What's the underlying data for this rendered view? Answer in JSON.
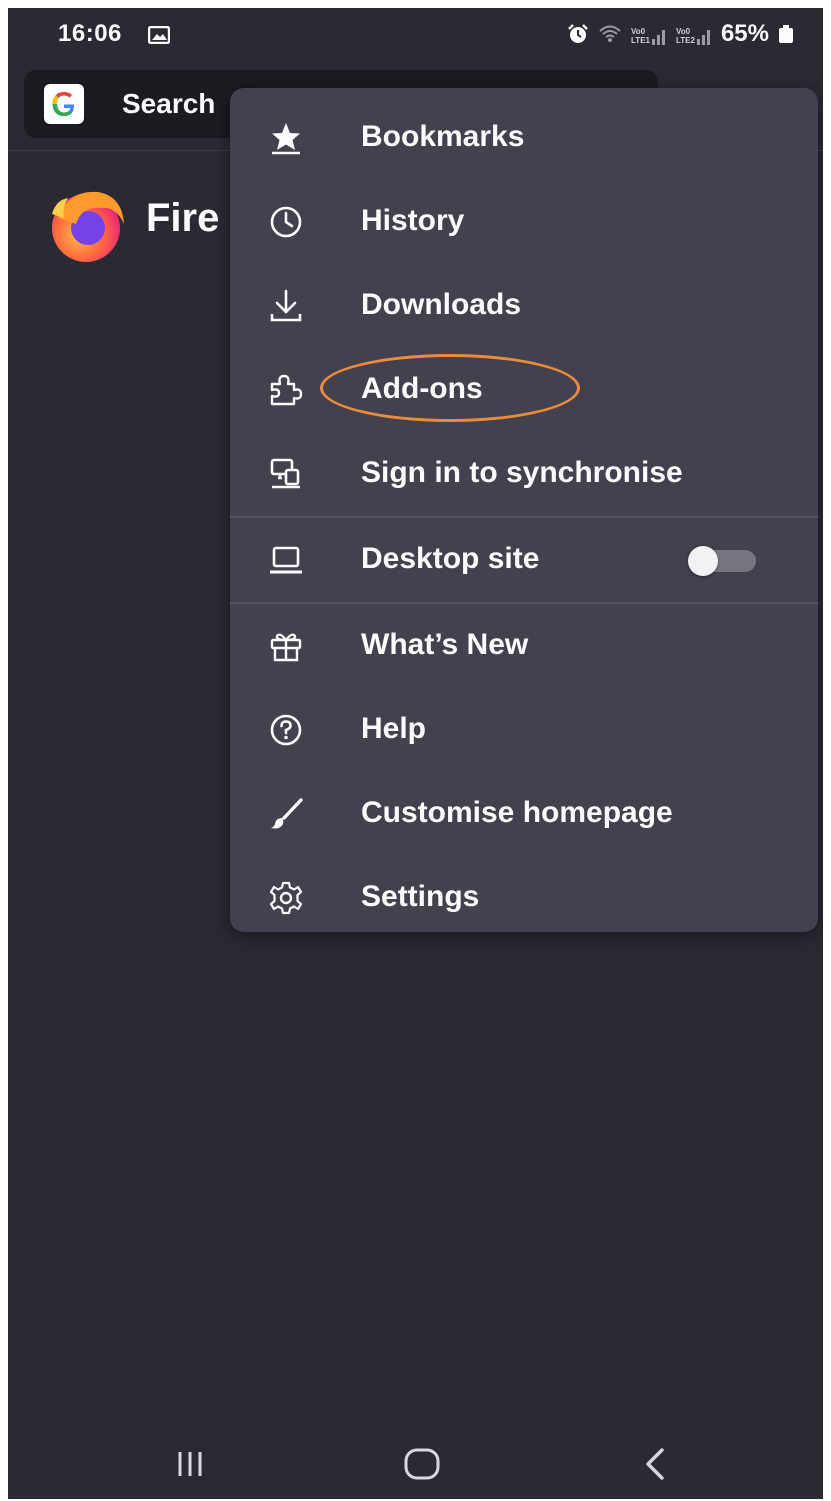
{
  "status_bar": {
    "time": "16:06",
    "battery": "65%",
    "lte1_top": "Vo0",
    "lte1_bottom": "LTE1",
    "lte2_top": "Vo0",
    "lte2_bottom": "LTE2",
    "icons": [
      "gallery-icon",
      "alarm-icon",
      "wifi-icon",
      "signal-icon",
      "battery-icon"
    ]
  },
  "toolbar": {
    "search_text": "Search",
    "engine_icon": "google-icon"
  },
  "home": {
    "wordmark": "Fire"
  },
  "menu": {
    "items": [
      {
        "label": "Bookmarks",
        "icon": "bookmark-star-icon"
      },
      {
        "label": "History",
        "icon": "clock-icon"
      },
      {
        "label": "Downloads",
        "icon": "download-icon"
      },
      {
        "label": "Add-ons",
        "icon": "puzzle-icon"
      },
      {
        "label": "Sign in to synchronise",
        "icon": "sync-devices-icon"
      },
      {
        "label": "Desktop site",
        "icon": "laptop-icon",
        "toggle_on": false
      },
      {
        "label": "What’s New",
        "icon": "gift-icon"
      },
      {
        "label": "Help",
        "icon": "help-circle-icon"
      },
      {
        "label": "Customise homepage",
        "icon": "brush-icon"
      },
      {
        "label": "Settings",
        "icon": "gear-icon"
      }
    ]
  },
  "colors": {
    "background": "#2b2a33",
    "menu": "#42414d",
    "text": "#fbfbfe",
    "highlight": "#ea8c3f"
  },
  "nav": {
    "icons": [
      "recent-apps-icon",
      "home-icon",
      "back-icon"
    ]
  }
}
